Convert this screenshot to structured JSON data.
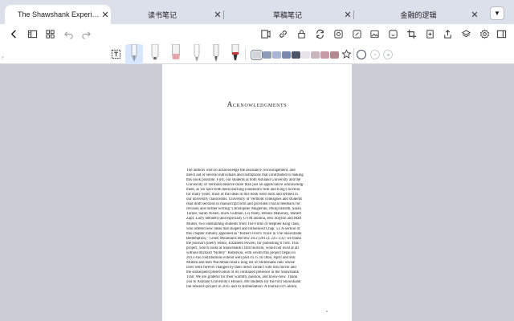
{
  "tabs": [
    {
      "title": "The Shawshank Experi…",
      "close": "✕"
    },
    {
      "title": "读书笔记",
      "close": "✕"
    },
    {
      "title": "草稿笔记",
      "close": "✕"
    },
    {
      "title": "金融的逻辑",
      "close": "✕"
    }
  ],
  "tabs_dropdown": "▼",
  "toolbar_left": [
    "back-icon",
    "sidebar-icon",
    "grid-icon",
    "undo-icon",
    "redo-icon"
  ],
  "toolbar_right": [
    "document-icon",
    "link-icon",
    "lock-icon",
    "sync-icon",
    "target-icon",
    "edit-icon",
    "image-icon",
    "sticker-icon",
    "crop-icon",
    "insert-page-icon",
    "share-icon",
    "layers-icon",
    "settings-icon",
    "panel-icon"
  ],
  "pens": [
    "text-tool",
    "fountain-pen",
    "highlighter",
    "eraser",
    "pencil",
    "ballpoint-pen",
    "marker"
  ],
  "colors": [
    "#d3d4d8",
    "#8e9bb6",
    "#a9b6cf",
    "#7888ad",
    "#4f5466",
    "#e7e2e6",
    "#c9b5bd",
    "#c69ba5",
    "#b3898f",
    "#6d6e71",
    "#3a3b3f"
  ],
  "document": {
    "title": "Acknowledgments",
    "paragraph_lines": [
      "The authors wish to acknowledge the assistance, encouragement, and",
      "direct aid of several individuals and institutions that contributed to making",
      "this book possible. First, our students at both Ashland University and the",
      "University of Vermont deserve more than just an appreciative acknowledg-",
      "ment, as we have both been teaching Darabont's film and King's novella",
      "for many years; most of the ideas in this book were born and refined in",
      "our university classrooms. University of Vermont colleagues and students",
      "read draft sections in manuscript form and provided crucial feedback for",
      "revision and further writing: Christopher Magierski, Philip Baruth, Sarah",
      "Turner, Sarah Nilsen, Huck Gutman, Liz Paley, Dennis Mahoney, Hubert",
      "Zapf, Larry Bennett (and especially UVM alumna, Jess Slayton and Matt",
      "Muller, two outstanding students from The Films of Stephen King class,",
      "who offered new ideas that shaped and influenced Chap. 5). A section of",
      "this chapter initially appeared as “Robert Frost's Voice in The Shawshank",
      "Redemption,” Green Mountains Review 28.2 (2015): 225–232; we thank",
      "the journal's poetry editor, Elizabeth Powell, for publishing it first. This",
      "project, which looks at Shawshank's film tourism, would not exist at all",
      "without Richard “Robby” Roberson, with whom this project began in",
      "2013–his contributions extend well past ch. 6. In Ohio, April and Bill",
      "Mullen and Bob Wachtman lead a long list of Shimshank fans whose",
      "lives were forever changed by their direct contact with this movie and",
      "the subsequent preservation of its continued presence in the Shawshank",
      "Trail. We are grateful for their warmth, passion, and know-how. Thank",
      "you to Ashland University's Honors 390 students for the first Shawshank",
      "fan research project in 2015 and to Alimentation: A Journal of Culture,"
    ],
    "page_number": "v"
  }
}
